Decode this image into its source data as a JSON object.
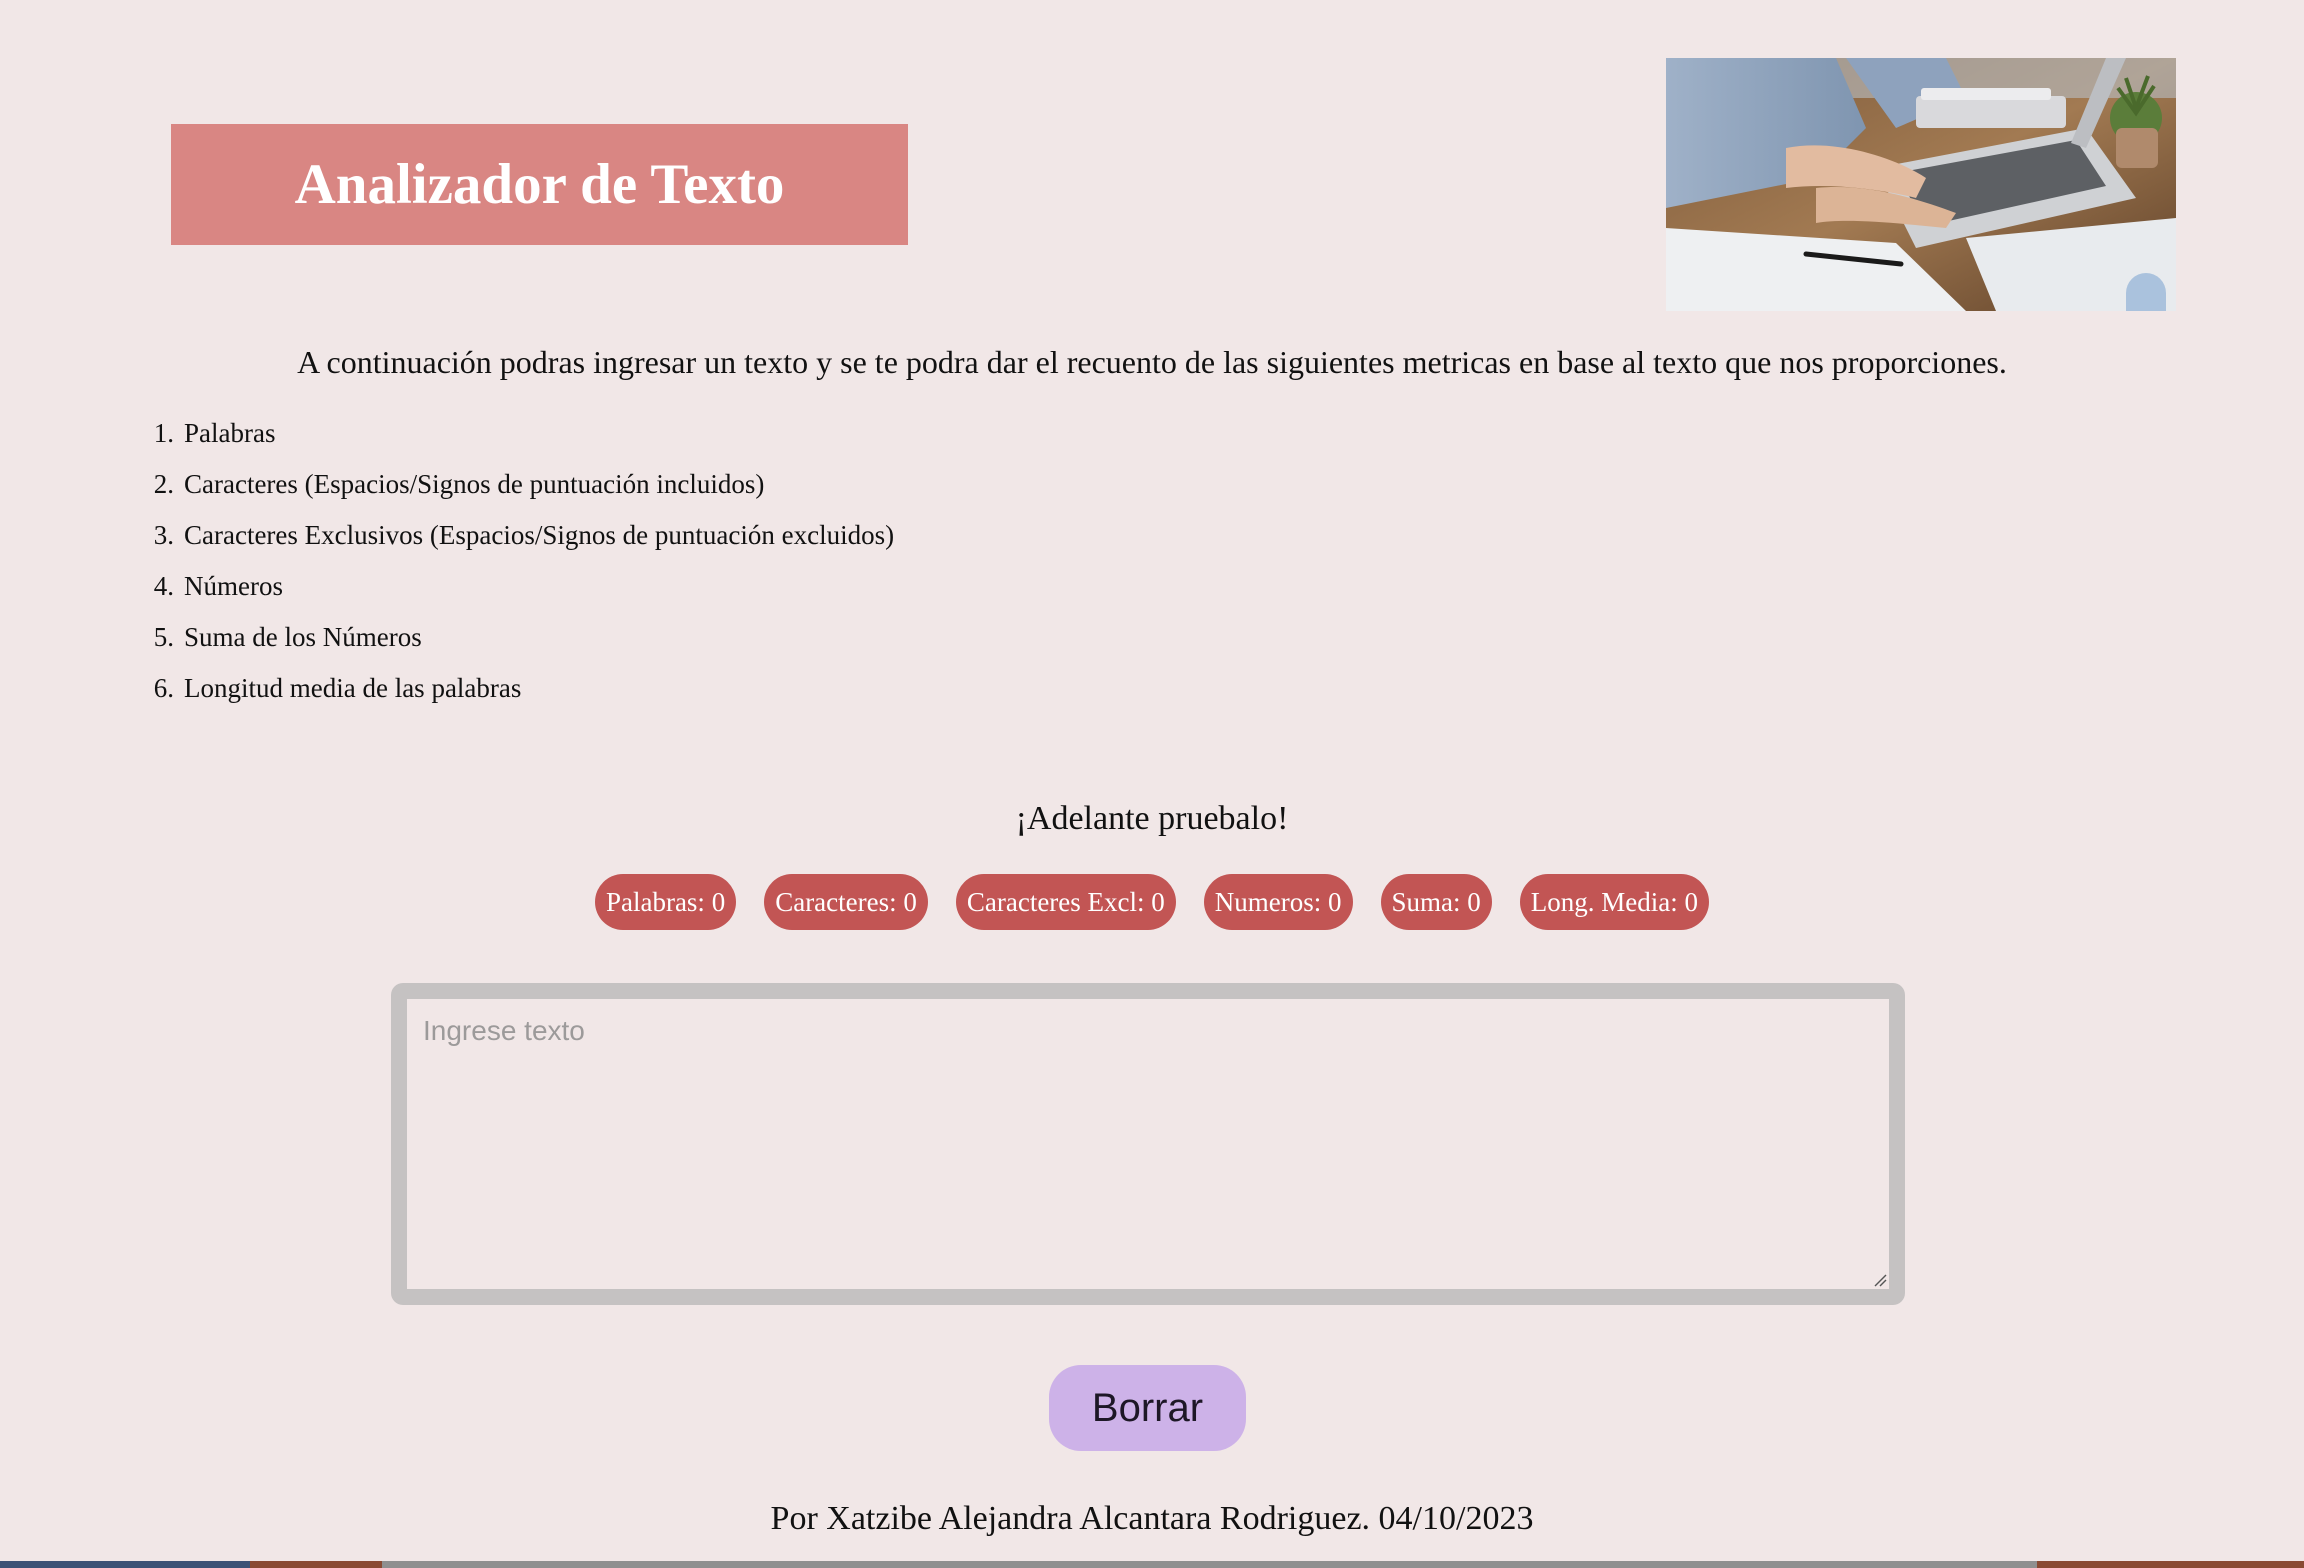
{
  "header": {
    "title": "Analizador de Texto",
    "image_icon": "laptop-typing-photo"
  },
  "intro": {
    "text": "A continuación podras ingresar un texto y se te podra dar el recuento de las siguientes metricas en base al texto que nos proporciones."
  },
  "metrics_list": [
    {
      "num": "1.",
      "label": "Palabras"
    },
    {
      "num": "2.",
      "label": "Caracteres (Espacios/Signos de puntuación incluidos)"
    },
    {
      "num": "3.",
      "label": "Caracteres Exclusivos (Espacios/Signos de puntuación excluidos)"
    },
    {
      "num": "4.",
      "label": "Números"
    },
    {
      "num": "5.",
      "label": "Suma de los Números"
    },
    {
      "num": "6.",
      "label": "Longitud media de las palabras"
    }
  ],
  "try_section": {
    "heading": "¡Adelante pruebalo!"
  },
  "counters": {
    "words": "Palabras: 0",
    "chars": "Caracteres: 0",
    "chars_excl": "Caracteres Excl: 0",
    "numbers": "Numeros: 0",
    "sum": "Suma: 0",
    "avg_length": "Long. Media: 0"
  },
  "input": {
    "placeholder": "Ingrese texto",
    "value": ""
  },
  "actions": {
    "clear_label": "Borrar"
  },
  "footer": {
    "text": "Por Xatzibe Alejandra Alcantara Rodriguez. 04/10/2023"
  },
  "colors": {
    "background": "#f1e7e7",
    "title_bg": "#d98683",
    "pill_bg": "#c25554",
    "button_bg": "#cdb2e8",
    "textarea_border": "#c5c2c2"
  }
}
